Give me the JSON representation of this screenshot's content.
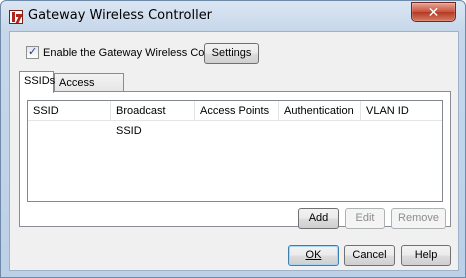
{
  "window": {
    "title": "Gateway Wireless Controller",
    "close_glyph": "✕"
  },
  "enable": {
    "label": "Enable the Gateway Wireless Controller",
    "checked": true
  },
  "settings_label": "Settings",
  "tabs": [
    {
      "label": "SSIDs",
      "active": true
    },
    {
      "label": "Access Points",
      "active": false
    }
  ],
  "list": {
    "columns": [
      "SSID",
      "Broadcast SSID",
      "Access Points",
      "Authentication",
      "VLAN ID"
    ],
    "rows": []
  },
  "list_buttons": {
    "add": "Add",
    "edit": "Edit",
    "remove": "Remove"
  },
  "dialog_buttons": {
    "ok": "OK",
    "cancel": "Cancel",
    "help": "Help"
  },
  "colors": {
    "titlebar": "#c6d7ea",
    "close_button": "#c9503a",
    "app_icon": "#b3261e"
  },
  "icons": {
    "app": "watchguard-logo-icon",
    "close": "close-icon",
    "check": "check-icon"
  }
}
